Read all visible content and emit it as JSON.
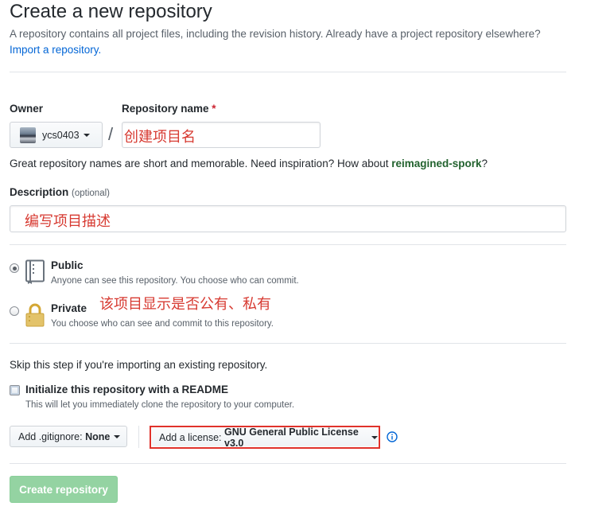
{
  "header": {
    "title": "Create a new repository",
    "subtitle": "A repository contains all project files, including the revision history. Already have a project repository elsewhere?",
    "import_link": "Import a repository."
  },
  "owner": {
    "label": "Owner",
    "selected": "ycs0403"
  },
  "repo_name": {
    "label": "Repository name",
    "required_mark": "*",
    "separator": "/",
    "annotation": "创建项目名"
  },
  "name_hint": {
    "text": "Great repository names are short and memorable. Need inspiration? How about ",
    "suggestion": "reimagined-spork",
    "suffix": "?"
  },
  "description": {
    "label": "Description",
    "optional": "(optional)",
    "annotation": "编写项目描述"
  },
  "visibility": {
    "annotation": "该项目显示是否公有、私有",
    "public": {
      "title": "Public",
      "desc": "Anyone can see this repository. You choose who can commit.",
      "checked": true
    },
    "private": {
      "title": "Private",
      "desc": "You choose who can see and commit to this repository.",
      "checked": false
    }
  },
  "init": {
    "skip_text": "Skip this step if you're importing an existing repository.",
    "readme_title": "Initialize this repository with a README",
    "readme_desc": "This will let you immediately clone the repository to your computer.",
    "readme_checked": false
  },
  "gitignore": {
    "label": "Add .gitignore: ",
    "value": "None"
  },
  "license": {
    "label": "Add a license: ",
    "value": "GNU General Public License v3.0",
    "highlight_color": "#e0322b"
  },
  "submit": {
    "label": "Create repository",
    "color": "#94d3a2"
  },
  "icons": {
    "public": "repo-book-icon",
    "private": "lock-icon",
    "info": "info-icon"
  }
}
